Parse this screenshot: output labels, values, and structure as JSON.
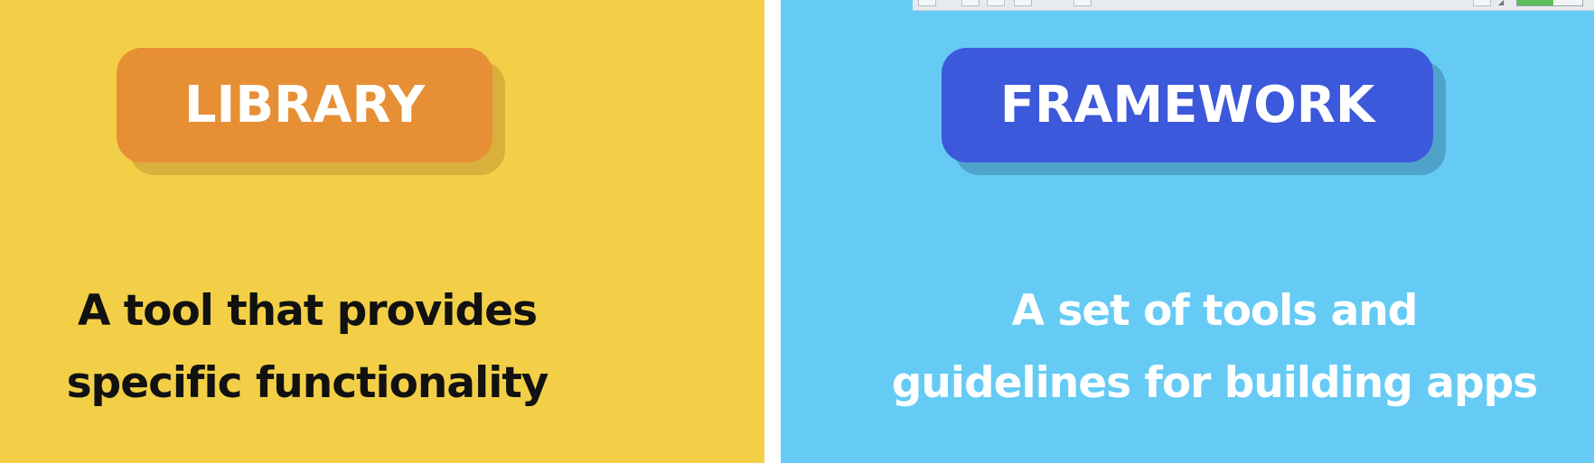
{
  "left": {
    "badge_label": "LIBRARY",
    "description_line1": "A tool that provides",
    "description_line2": "specific functionality",
    "colors": {
      "background": "#f2cf47",
      "badge": "#e78f35",
      "badge_shadow": "#d8b03b",
      "text": "#111111"
    }
  },
  "right": {
    "badge_label": "FRAMEWORK",
    "description_line1": "A set of tools and",
    "description_line2": "guidelines for building apps",
    "colors": {
      "background": "#65cbf4",
      "badge": "#3c58db",
      "badge_shadow": "#4fa2c9",
      "text": "#ffffff"
    }
  },
  "toolbar": {
    "speaker_icon": "speaker-icon",
    "volume_level": 0.55,
    "volume_color": "#5cc05a"
  }
}
